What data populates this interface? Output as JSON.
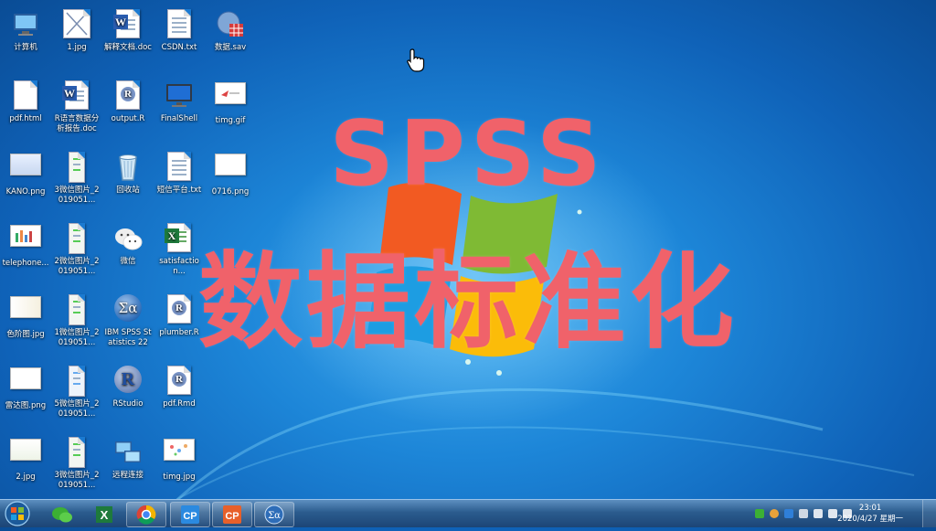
{
  "desktop": {
    "icons": [
      {
        "label": "计算机"
      },
      {
        "label": "1.jpg"
      },
      {
        "label": "解释文档.doc"
      },
      {
        "label": "CSDN.txt"
      },
      {
        "label": "数据.sav"
      },
      {
        "label": "pdf.html"
      },
      {
        "label": "R语言数据分析报告.doc"
      },
      {
        "label": "output.R"
      },
      {
        "label": "FinalShell"
      },
      {
        "label": "timg.gif"
      },
      {
        "label": "KANO.png"
      },
      {
        "label": "3微信图片_2019051..."
      },
      {
        "label": "回收站"
      },
      {
        "label": "短信平台.txt"
      },
      {
        "label": "0716.png"
      },
      {
        "label": "telephone..."
      },
      {
        "label": "2微信图片_2019051..."
      },
      {
        "label": "微信"
      },
      {
        "label": "satisfaction..."
      },
      {
        "label": "色阶图.jpg"
      },
      {
        "label": "1微信图片_2019051..."
      },
      {
        "label": "IBM SPSS Statistics 22"
      },
      {
        "label": "plumber.R"
      },
      {
        "label": "雷达图.png"
      },
      {
        "label": "5微信图片_2019051..."
      },
      {
        "label": "RStudio"
      },
      {
        "label": "pdf.Rmd"
      },
      {
        "label": "2.jpg"
      },
      {
        "label": "3微信图片_2019051..."
      },
      {
        "label": "远程连接"
      },
      {
        "label": "timg.jpg"
      }
    ]
  },
  "overlay": {
    "line1": "SPSS",
    "line2": "数据标准化"
  },
  "taskbar": {
    "items": [
      "start",
      "wechat",
      "excel",
      "chrome",
      "cp1",
      "cp2",
      "spss"
    ],
    "clock_time": "23:01",
    "clock_date": "2020/4/27 星期一"
  },
  "colors": {
    "overlay_text": "#f0626a",
    "wallpaper": "#1d86d8",
    "taskbar": "#2b5c8e"
  }
}
